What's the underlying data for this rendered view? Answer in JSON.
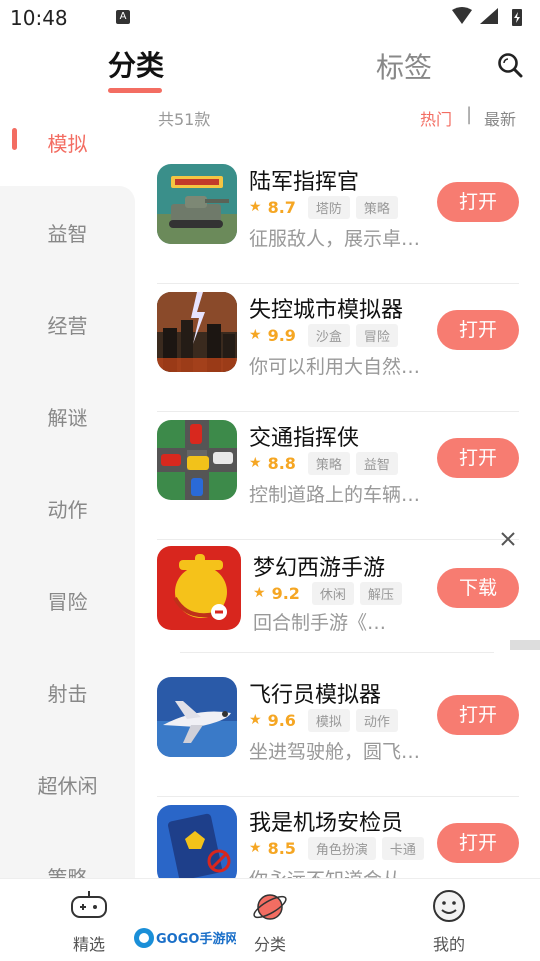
{
  "status": {
    "time": "10:48",
    "notif": "A"
  },
  "header": {
    "tab_active": "分类",
    "tab_other": "标签"
  },
  "sidebar": {
    "active": "模拟",
    "items": [
      "益智",
      "经营",
      "解谜",
      "动作",
      "冒险",
      "射击",
      "超休闲",
      "策略"
    ]
  },
  "list": {
    "count": "共51款",
    "sort_hot": "热门",
    "sort_sep": "|",
    "sort_new": "最新"
  },
  "apps": [
    {
      "name": "陆军指挥官",
      "rating": "8.7",
      "tags": [
        "塔防",
        "策略"
      ],
      "desc": "征服敌人，展示卓…",
      "button": "打开",
      "icon": "tank-game-icon"
    },
    {
      "name": "失控城市模拟器",
      "rating": "9.9",
      "tags": [
        "沙盒",
        "冒险"
      ],
      "desc": "你可以利用大自然…",
      "button": "打开",
      "icon": "city-storm-icon"
    },
    {
      "name": "交通指挥侠",
      "rating": "8.8",
      "tags": [
        "策略",
        "益智"
      ],
      "desc": "控制道路上的车辆…",
      "button": "打开",
      "icon": "traffic-cars-icon"
    },
    {
      "name": "梦幻西游手游",
      "rating": "9.2",
      "tags": [
        "休闲",
        "解压"
      ],
      "desc": "回合制手游《…",
      "button": "下载",
      "icon": "menghuan-icon"
    },
    {
      "name": "飞行员模拟器",
      "rating": "9.6",
      "tags": [
        "模拟",
        "动作"
      ],
      "desc": "坐进驾驶舱，圆飞…",
      "button": "打开",
      "icon": "airplane-icon"
    },
    {
      "name": "我是机场安检员",
      "rating": "8.5",
      "tags": [
        "角色扮演",
        "卡通"
      ],
      "desc": "你永远不知道会从…",
      "button": "打开",
      "icon": "passport-icon"
    }
  ],
  "nav": {
    "featured": "精选",
    "category": "分类",
    "mine": "我的"
  },
  "watermark": "GOGO手游网",
  "colors": {
    "accent": "#f36d62",
    "button": "#f77c71",
    "rating": "#f5a623"
  }
}
